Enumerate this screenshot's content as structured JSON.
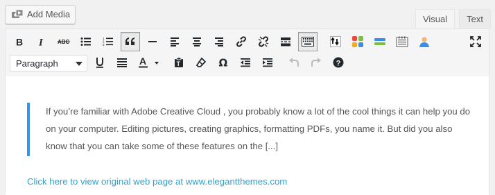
{
  "add_media": {
    "label": "Add Media",
    "icon": "media-camera-icon"
  },
  "tabs": [
    {
      "label": "Visual",
      "active": true
    },
    {
      "label": "Text",
      "active": false
    }
  ],
  "toolbar": {
    "row1": [
      "bold-icon",
      "italic-icon",
      "strikethrough-icon",
      "bullet-list-icon",
      "numbered-list-icon",
      "blockquote-icon",
      "horizontal-line-icon",
      "align-left-icon",
      "align-center-icon",
      "align-right-icon",
      "link-icon",
      "unlink-icon",
      "read-more-icon",
      "toolbar-toggle-icon",
      "plugin-arrows-icon",
      "plugin-grid-icon",
      "plugin-bars-icon",
      "plugin-notepad-icon",
      "plugin-user-icon",
      "fullscreen-icon"
    ],
    "row2_format": "Paragraph",
    "row2": [
      "underline-icon",
      "justify-icon",
      "text-color-icon",
      "paste-as-text-icon",
      "clear-formatting-icon",
      "special-character-icon",
      "outdent-icon",
      "indent-icon",
      "undo-icon",
      "redo-icon",
      "help-icon"
    ]
  },
  "content": {
    "blockquote": "If you’re familiar with Adobe Creative Cloud , you probably know a lot of the cool things it can help you do on your computer. Editing pictures, creating graphics, formatting PDFs, you name it. But did you also know that you can take some of these features on the [...]",
    "link_text": "Click here to view original web page at www.elegantthemes.com"
  },
  "colors": {
    "accent": "#3b93e0",
    "link": "#2ea2cc",
    "text": "#555555",
    "toolbar_bg": "#f5f5f5"
  }
}
